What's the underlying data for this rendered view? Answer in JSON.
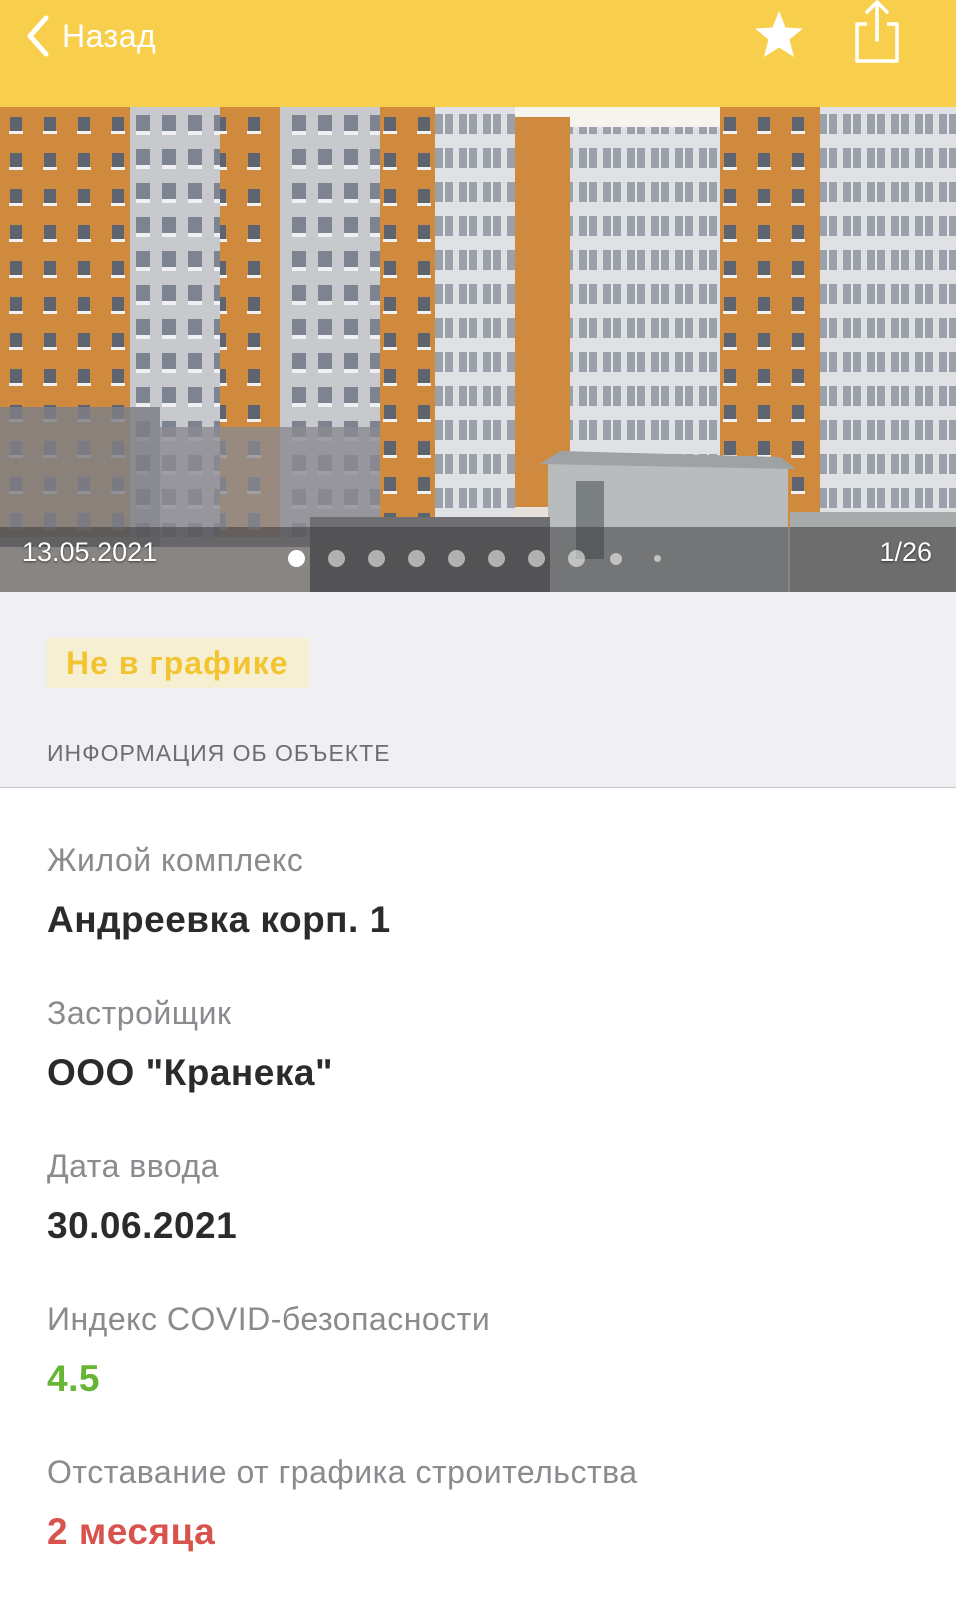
{
  "navbar": {
    "back_label": "Назад",
    "background": "#f8cf4d",
    "icons": [
      "chevron-left-icon",
      "star-icon",
      "share-icon"
    ]
  },
  "gallery": {
    "date": "13.05.2021",
    "counter": "1/26",
    "current_index": 1,
    "total": 26
  },
  "status": {
    "badge": "Не в графике",
    "badge_color": "#f3c432"
  },
  "section": {
    "header": "ИНФОРМАЦИЯ ОБ ОБЪЕКТЕ"
  },
  "info": {
    "complex_label": "Жилой комплекс",
    "complex_value": "Андреевка корп. 1",
    "developer_label": "Застройщик",
    "developer_value": "ООО \"Кранека\"",
    "date_label": "Дата ввода",
    "date_value": "30.06.2021",
    "covid_label": "Индекс COVID-безопасности",
    "covid_value": "4.5",
    "covid_color": "#66b534",
    "delay_label": "Отставание от графика строительства",
    "delay_value": "2 месяца",
    "delay_color": "#d8534d"
  }
}
